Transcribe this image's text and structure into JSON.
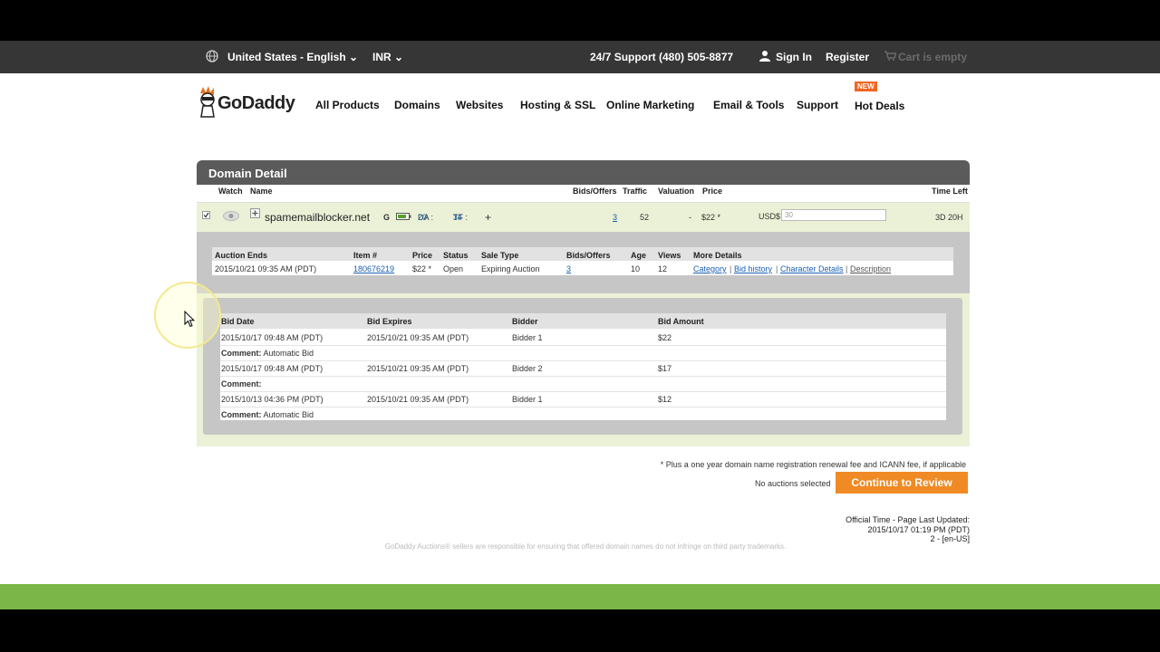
{
  "topbar": {
    "locale": "United States - English",
    "currency": "INR",
    "support": "24/7 Support (480) 505-8877",
    "sign_in": "Sign In",
    "register": "Register",
    "cart": "Cart is empty"
  },
  "nav": {
    "logo": "GoDaddy",
    "items": [
      "All Products",
      "Domains",
      "Websites",
      "Hosting & SSL",
      "Online Marketing",
      "Email & Tools",
      "Support",
      "Hot Deals"
    ],
    "badge": "NEW"
  },
  "panel": {
    "title": "Domain Detail",
    "columns": {
      "watch": "Watch",
      "name": "Name",
      "bids": "Bids/Offers",
      "traffic": "Traffic",
      "valuation": "Valuation",
      "price": "Price",
      "time_left": "Time Left"
    },
    "domain": {
      "name": "spamemailblocker.net",
      "g": "G",
      "da_label": "DA :",
      "da": "20",
      "tf_label": "TF :",
      "tf": "34",
      "plus": "+",
      "bids": "3",
      "traffic": "52",
      "valuation": "-",
      "price": "$22 *",
      "usd_label": "USD$",
      "usd_value": "30",
      "time_left": "3D 20H"
    }
  },
  "auction": {
    "headers": [
      "Auction Ends",
      "Item #",
      "Price",
      "Status",
      "Sale Type",
      "Bids/Offers",
      "Age",
      "Views",
      "More Details"
    ],
    "row": {
      "ends": "2015/10/21 09:35 AM (PDT)",
      "item": "180676219",
      "price": "$22 *",
      "status": "Open",
      "sale_type": "Expiring Auction",
      "bids": "3",
      "age": "10",
      "views": "12"
    },
    "links": [
      "Category",
      "Bid history",
      "Character Details",
      "Description"
    ],
    "separator": "|"
  },
  "bids": {
    "headers": [
      "Bid Date",
      "Bid Expires",
      "Bidder",
      "Bid Amount"
    ],
    "comment_label": "Comment:",
    "rows": [
      {
        "date": "2015/10/17 09:48 AM (PDT)",
        "expires": "2015/10/21 09:35 AM (PDT)",
        "bidder": "Bidder 1",
        "amount": "$22",
        "comment": "Automatic Bid"
      },
      {
        "date": "2015/10/17 09:48 AM (PDT)",
        "expires": "2015/10/21 09:35 AM (PDT)",
        "bidder": "Bidder 2",
        "amount": "$17",
        "comment": ""
      },
      {
        "date": "2015/10/13 04:36 PM (PDT)",
        "expires": "2015/10/21 09:35 AM (PDT)",
        "bidder": "Bidder 1",
        "amount": "$12",
        "comment": "Automatic Bid"
      }
    ]
  },
  "footer": {
    "note": "* Plus a one year domain name registration renewal fee and ICANN fee, if applicable",
    "no_auctions": "No auctions selected",
    "review_button": "Continue to Review",
    "official_time_label": "Official Time - Page Last Updated:",
    "official_time": "2015/10/17 01:19 PM (PDT)",
    "locale_code": "2 - [en-US]",
    "disclaimer": "GoDaddy Auctions® sellers are responsible for ensuring that offered domain names do not infringe on third party trademarks."
  }
}
